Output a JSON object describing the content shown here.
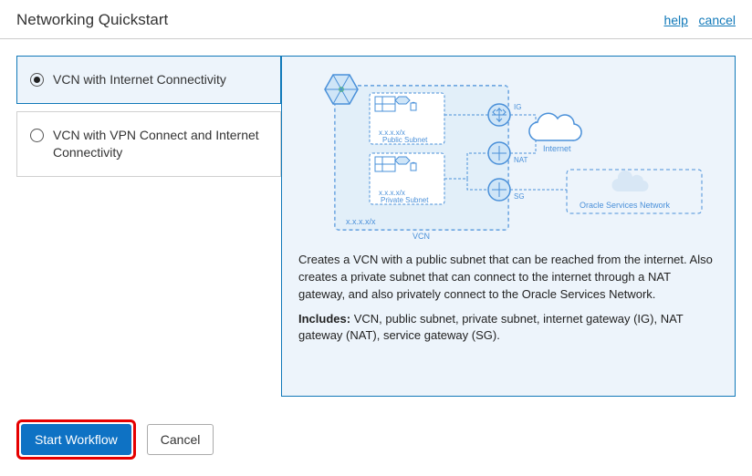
{
  "header": {
    "title": "Networking Quickstart",
    "help_link": "help",
    "cancel_link": "cancel"
  },
  "options": [
    {
      "id": "opt-internet",
      "label": "VCN with Internet Connectivity",
      "selected": true
    },
    {
      "id": "opt-vpn",
      "label": "VCN with VPN Connect and Internet Connectivity",
      "selected": false
    }
  ],
  "detail": {
    "diagram": {
      "vcn_label": "VCN",
      "vcn_cidr": "x.x.x.x/x",
      "public_subnet_label": "Public Subnet",
      "public_subnet_cidr": "x.x.x.x/x",
      "private_subnet_label": "Private Subnet",
      "private_subnet_cidr": "x.x.x.x/x",
      "ig_label": "IG",
      "nat_label": "NAT",
      "sg_label": "SG",
      "internet_label": "Internet",
      "osn_label": "Oracle Services Network"
    },
    "description": "Creates a VCN with a public subnet that can be reached from the internet. Also creates a private subnet that can connect to the internet through a NAT gateway, and also privately connect to the Oracle Services Network.",
    "includes_label": "Includes:",
    "includes_text": " VCN, public subnet, private subnet, internet gateway (IG), NAT gateway (NAT), service gateway (SG)."
  },
  "footer": {
    "start_label": "Start Workflow",
    "cancel_label": "Cancel"
  }
}
